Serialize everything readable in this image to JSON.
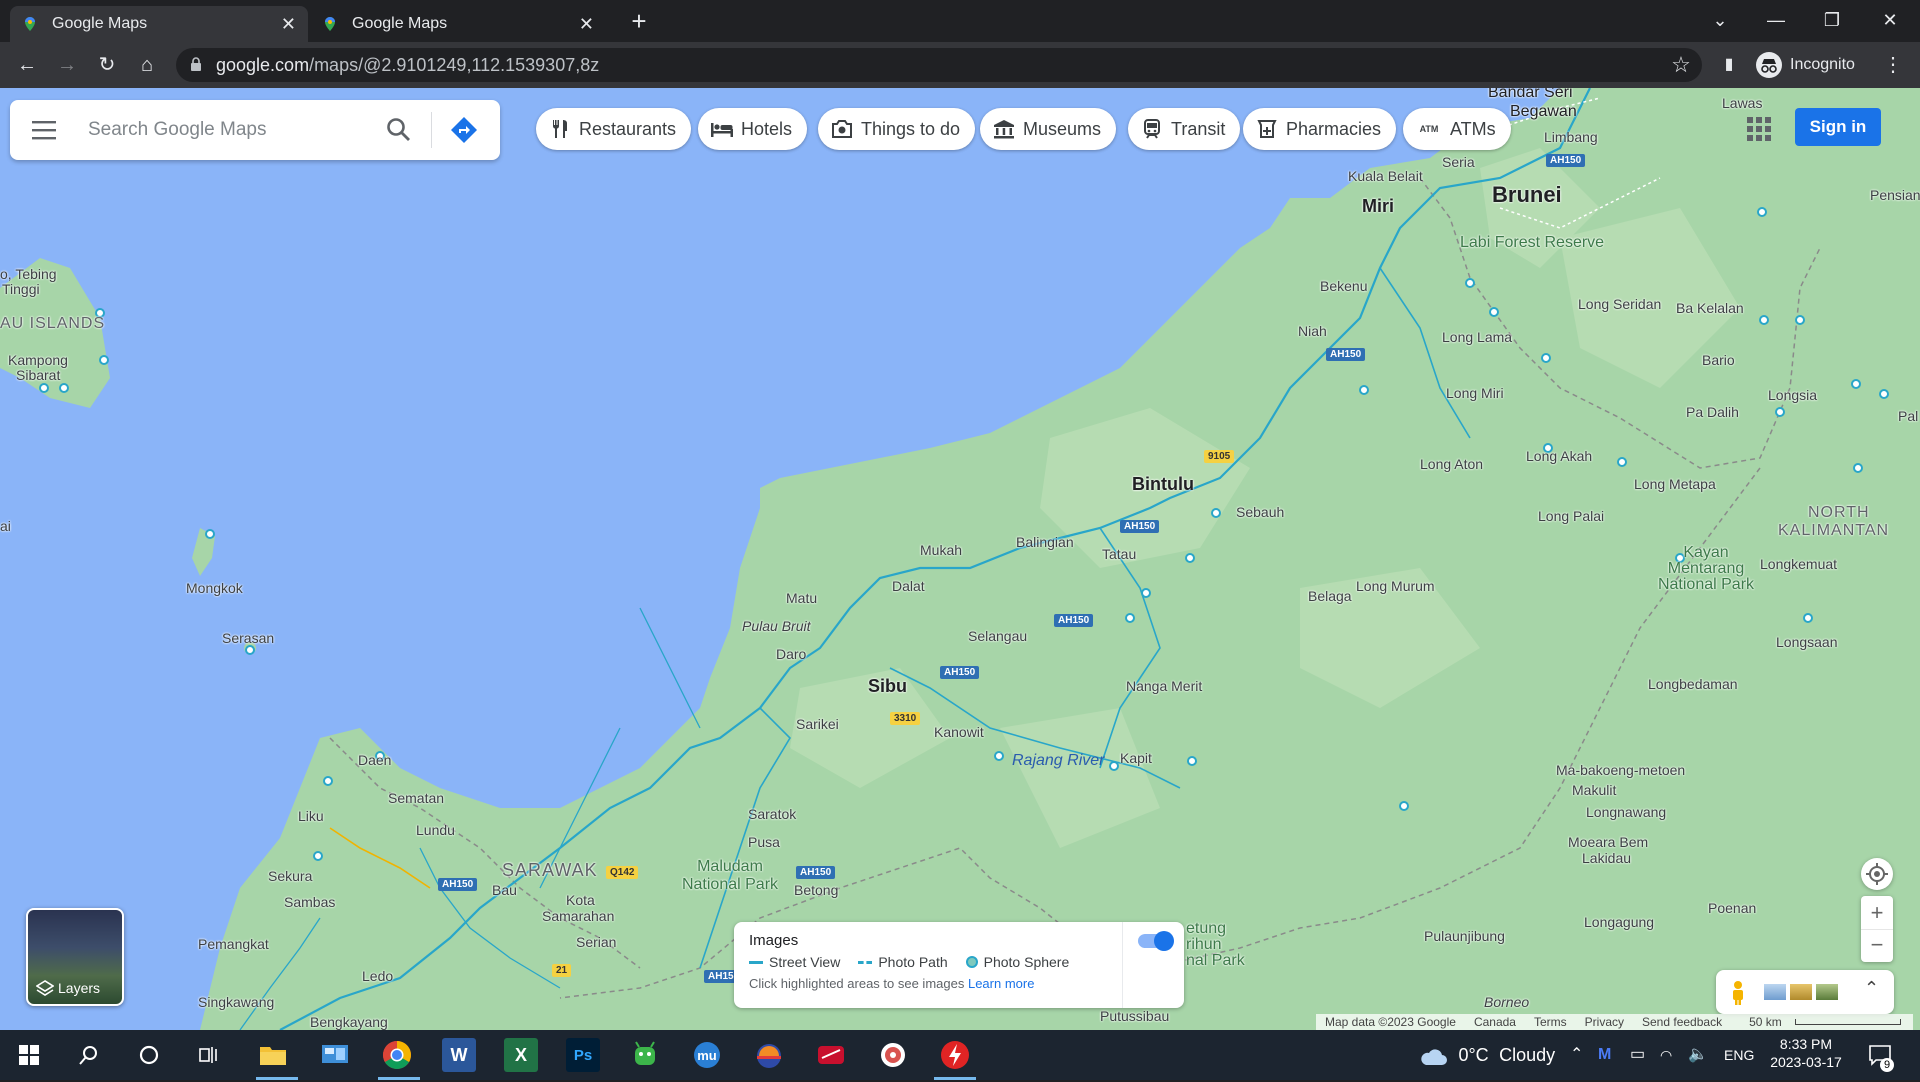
{
  "browser": {
    "tabs": [
      {
        "title": "Google Maps",
        "active": true
      },
      {
        "title": "Google Maps",
        "active": false
      }
    ],
    "url_host": "google.com",
    "url_path": "/maps/@2.9101249,112.1539307,8z",
    "incognito_label": "Incognito"
  },
  "search": {
    "placeholder": "Search Google Maps"
  },
  "chips": [
    {
      "label": "Restaurants",
      "icon": "restaurant-icon"
    },
    {
      "label": "Hotels",
      "icon": "hotel-icon"
    },
    {
      "label": "Things to do",
      "icon": "camera-icon"
    },
    {
      "label": "Museums",
      "icon": "museum-icon"
    },
    {
      "label": "Transit",
      "icon": "train-icon"
    },
    {
      "label": "Pharmacies",
      "icon": "pharmacy-icon"
    },
    {
      "label": "ATMs",
      "icon": "atm-icon"
    }
  ],
  "chip_atm_glyph": "ATM",
  "sign_in": "Sign in",
  "layers_label": "Layers",
  "images_card": {
    "title": "Images",
    "street_view": "Street View",
    "photo_path": "Photo Path",
    "photo_sphere": "Photo Sphere",
    "hint": "Click highlighted areas to see images",
    "learn_more": "Learn more",
    "toggle_on": true
  },
  "map_labels": {
    "bandar_seri": "Bandar Seri",
    "begawan": "Begawan",
    "lawas": "Lawas",
    "limbang": "Limbang",
    "seria": "Seria",
    "brunei": "Brunei",
    "kuala_belait": "Kuala Belait",
    "miri": "Miri",
    "pensian": "Pensian",
    "labi_forest_reserve": "Labi Forest Reserve",
    "bekenu": "Bekenu",
    "long_seridan": "Long Seridan",
    "bakelalan": "Ba Kelalan",
    "niah": "Niah",
    "long_lama": "Long Lama",
    "bario": "Bario",
    "longsia": "Longsia",
    "long_miri": "Long Miri",
    "pa_dalih": "Pa Dalih",
    "pal": "Pal",
    "long_aton": "Long Aton",
    "long_akah": "Long Akah",
    "long_metapa": "Long Metapa",
    "bintulu": "Bintulu",
    "sebauh": "Sebauh",
    "long_palai": "Long Palai",
    "north_kalimantan_1": "NORTH",
    "north_kalimantan_2": "KALIMANTAN",
    "tebing_tinggi_1": "o, Tebing",
    "tebing_tinggi_2": "Tinggi",
    "au_islands": "AU ISLANDS",
    "kampong_sibarat_1": "Kampong",
    "kampong_sibarat_2": "Sibarat",
    "ai": "ai",
    "mukah": "Mukah",
    "balingian": "Balingian",
    "tatau": "Tatau",
    "kayan_mentarang_1": "Kayan",
    "kayan_mentarang_2": "Mentarang",
    "kayan_mentarang_3": "National Park",
    "longkemuat": "Longkemuat",
    "mongkok": "Mongkok",
    "matu": "Matu",
    "dalat": "Dalat",
    "belaga": "Belaga",
    "long_murum": "Long Murum",
    "pulau_bruit": "Pulau Bruit",
    "selangau": "Selangau",
    "serasan": "Serasan",
    "daro": "Daro",
    "longsaan": "Longsaan",
    "sibu": "Sibu",
    "nanga_merit": "Nanga Merit",
    "longbedaman": "Longbedaman",
    "sarikei": "Sarikei",
    "kanowit": "Kanowit",
    "rajang_river": "Rajang River",
    "kapit": "Kapit",
    "daen": "Daen",
    "ma_bakoeng": "Ma-bakoeng-metoen",
    "makulit": "Makulit",
    "sematan": "Sematan",
    "lundu": "Lundu",
    "liku": "Liku",
    "saratok": "Saratok",
    "longnawang": "Longnawang",
    "moeara_bem_1": "Moeara Bem",
    "moeara_bem_2": "Lakidau",
    "sarawak": "SARAWAK",
    "pusa": "Pusa",
    "maludam_1": "Maludam",
    "maludam_2": "National Park",
    "betong": "Betong",
    "sekura": "Sekura",
    "bau": "Bau",
    "kota_samarahan_1": "Kota",
    "kota_samarahan_2": "Samarahan",
    "sambas": "Sambas",
    "poenan": "Poenan",
    "longagung": "Longagung",
    "pemangkat": "Pemangkat",
    "serian": "Serian",
    "pulaunjibung": "Pulaunjibung",
    "ledo": "Ledo",
    "singkawang": "Singkawang",
    "bengkayang": "Bengkayang",
    "borneo": "Borneo",
    "putussibau": "Putussibau",
    "betung_1": "etung",
    "betung_2": "rihun",
    "betung_3": "nal Park"
  },
  "road_shields": {
    "ah150_brunei": "AH150",
    "ah150_niah": "AH150",
    "r9105": "9105",
    "ah150_bintulu": "AH150",
    "ah150_selangau": "AH150",
    "ah150_sibu": "AH150",
    "r3310": "3310",
    "ah150_betong": "AH150",
    "q142": "Q142",
    "ah150_kuching": "AH150",
    "r21": "21",
    "ah15_card": "AH15"
  },
  "footer": {
    "map_data": "Map data ©2023 Google",
    "canada": "Canada",
    "terms": "Terms",
    "privacy": "Privacy",
    "send_feedback": "Send feedback",
    "scale": "50 km"
  },
  "taskbar": {
    "weather_temp": "0°C",
    "weather_desc": "Cloudy",
    "language": "ENG",
    "time": "8:33 PM",
    "date": "2023-03-17",
    "notification_count": "9"
  },
  "colors": {
    "sea": "#8ab4f8",
    "land": "#a7d5a8",
    "land_light": "#b6dcb2",
    "accent": "#1a73e8",
    "road": "#29a6c9"
  }
}
